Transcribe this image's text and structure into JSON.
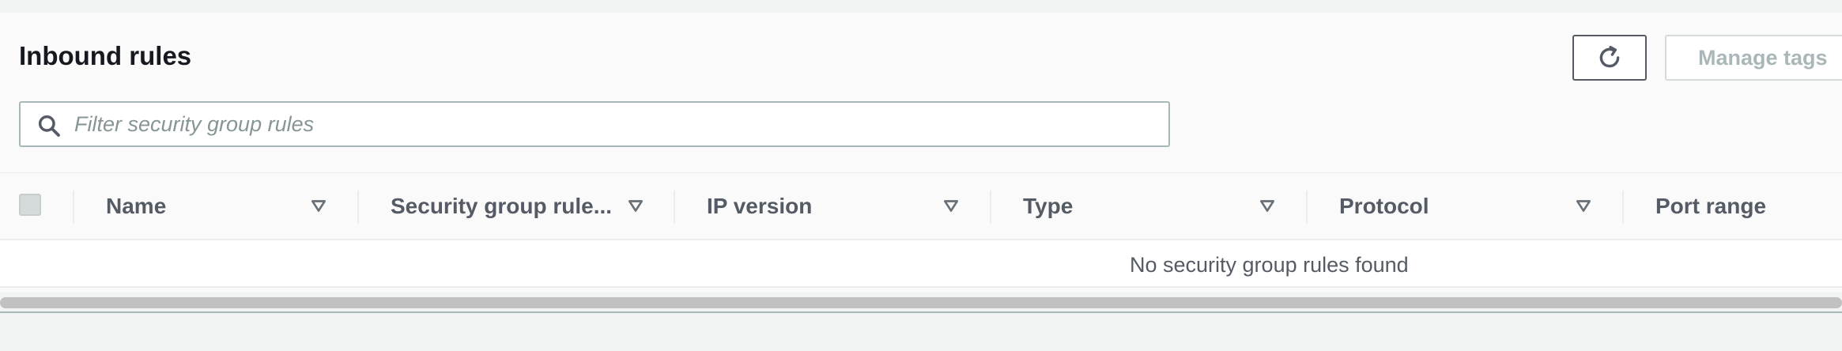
{
  "panel": {
    "title": "Inbound rules"
  },
  "toolbar": {
    "refresh_icon": "refresh-icon",
    "manage_tags_label": "Manage tags"
  },
  "search": {
    "placeholder": "Filter security group rules",
    "value": "",
    "icon": "search-icon"
  },
  "table": {
    "columns": [
      {
        "label": "Name",
        "sortable": true
      },
      {
        "label": "Security group rule...",
        "sortable": true
      },
      {
        "label": "IP version",
        "sortable": true
      },
      {
        "label": "Type",
        "sortable": true
      },
      {
        "label": "Protocol",
        "sortable": true
      },
      {
        "label": "Port range",
        "sortable": false
      }
    ],
    "empty_message": "No security group rules found",
    "rows": []
  },
  "colors": {
    "title_text": "#16191f",
    "header_text": "#545b64",
    "disabled_text": "#aab7b8",
    "placeholder_text": "#879596",
    "panel_bg": "#fafafa",
    "page_bg": "#f2f3f3"
  }
}
